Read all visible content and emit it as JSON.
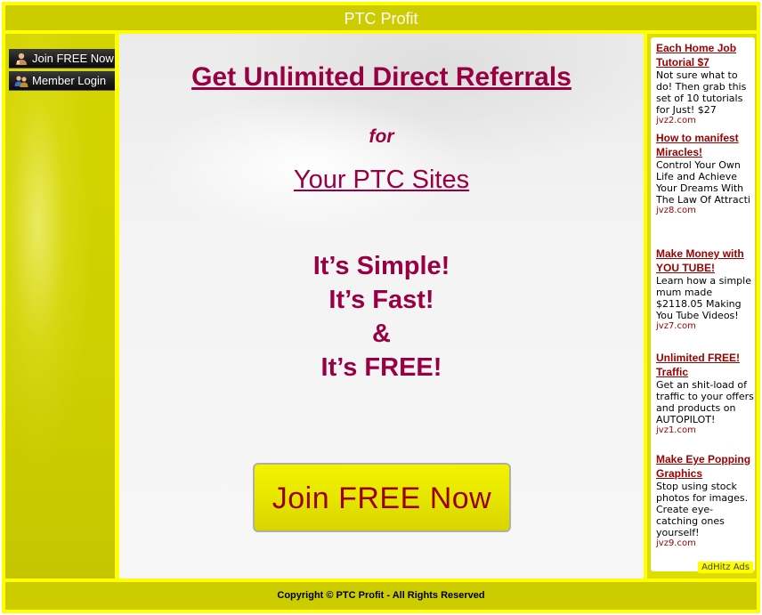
{
  "header": {
    "title": "PTC Profit"
  },
  "sidebar": {
    "items": [
      {
        "label": "Join FREE Now",
        "icon": "person-icon"
      },
      {
        "label": "Member Login",
        "icon": "users-icon"
      }
    ]
  },
  "main": {
    "headline": "Get Unlimited Direct Referrals",
    "for_text": "for",
    "subheadline": "Your PTC Sites",
    "taglines": [
      "It’s Simple!",
      "It’s Fast!",
      "&",
      "It’s FREE!"
    ],
    "cta_label": "Join FREE Now"
  },
  "ads": {
    "items": [
      {
        "title": "Each Home Job Tutorial $7",
        "desc": "Not sure what to do! Then grab this set of 10 tutorials for Just! $27",
        "url": "jvz2.com"
      },
      {
        "title": "How to manifest Miracles!",
        "desc": "Control Your Own Life and Achieve Your Dreams With The Law Of Attracti",
        "url": "jvz8.com"
      },
      {
        "title": "Make Money with YOU TUBE!",
        "desc": "Learn how a simple mum made $2118.05 Making You Tube Videos!",
        "url": "jvz7.com"
      },
      {
        "title": "Unlimited FREE! Traffic",
        "desc": "Get an shit-load of traffic to your offers and products on AUTOPILOT!",
        "url": "jvz1.com"
      },
      {
        "title": "Make Eye Popping Graphics",
        "desc": "Stop using stock photos for images. Create eye-catching ones yourself!",
        "url": "jvz9.com"
      }
    ],
    "badge": "AdHitz Ads"
  },
  "footer": {
    "copyright": "Copyright © PTC Profit - All Rights Reserved"
  },
  "colors": {
    "frame": "#ffff00",
    "bar": "#cccc00",
    "maroon": "#990044",
    "ad_title": "#990000"
  }
}
